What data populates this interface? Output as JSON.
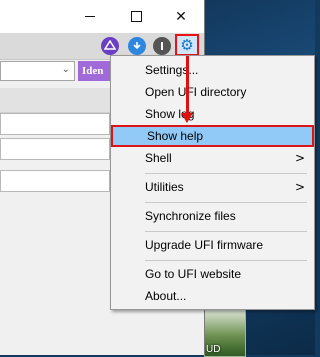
{
  "window": {
    "minimize_glyph": "",
    "maximize_glyph": "",
    "close_glyph": "✕"
  },
  "toolbar": {
    "identify_button_label": "Iden",
    "combo_arrow": "⌄",
    "icons": [
      "blue-purple-logo-icon",
      "download-icon",
      "info-icon",
      "gear-icon"
    ],
    "gear_glyph": "⚙",
    "gear_highlight_color": "#e11111"
  },
  "menu": {
    "items": [
      {
        "label": "Settings..."
      },
      {
        "label": "Open UFI directory"
      },
      {
        "label": "Show log"
      },
      {
        "label": "Show help"
      },
      {
        "label": "Shell",
        "submenu_arrow": ">"
      },
      {
        "label": "Utilities",
        "submenu_arrow": ">"
      },
      {
        "label": "Synchronize files"
      },
      {
        "label": "Upgrade UFI firmware"
      },
      {
        "label": "Go to UFI website"
      },
      {
        "label": "About..."
      }
    ],
    "highlight_color": "#91c9f7",
    "annotation_color": "#e01010"
  },
  "desktop": {
    "icon_label": "UD"
  }
}
